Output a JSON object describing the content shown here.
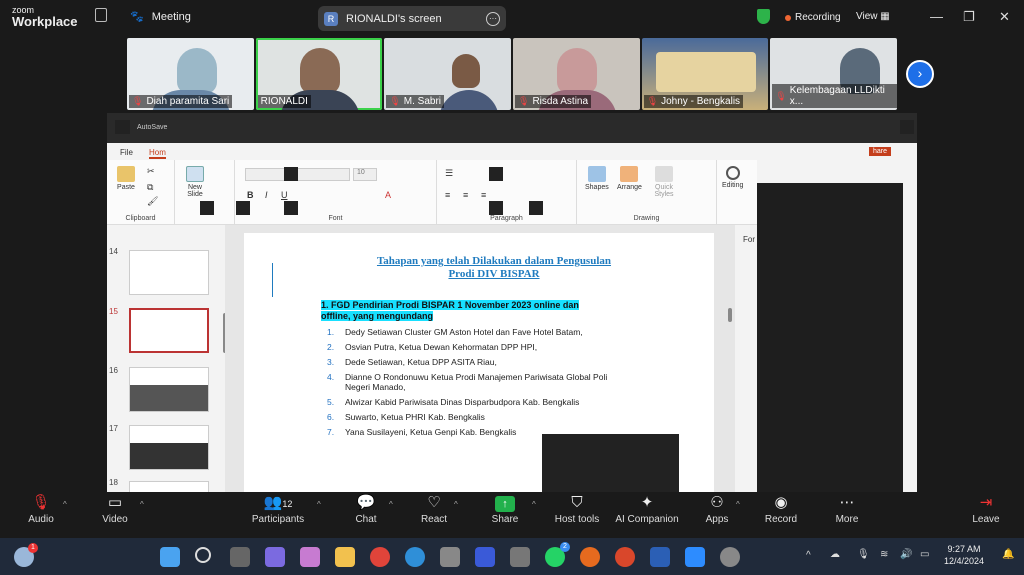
{
  "app": {
    "brand_top": "zoom",
    "brand_bottom": "Workplace",
    "meeting_label": "Meeting",
    "screen_label": "RIONALDI's screen",
    "screen_initial": "R",
    "recording_label": "Recording",
    "view_label": "View"
  },
  "participants": [
    {
      "name": "Diah paramita Sari",
      "muted": true
    },
    {
      "name": "RIONALDI",
      "muted": false
    },
    {
      "name": "M. Sabri",
      "muted": true
    },
    {
      "name": "Risda Astina",
      "muted": true
    },
    {
      "name": "Johny - Bengkalis",
      "muted": true
    },
    {
      "name": "Kelembagaan LLDikti x...",
      "muted": true
    }
  ],
  "ppt": {
    "autosave": "AutoSave",
    "menu_file": "File",
    "menu_home": "Hom",
    "share": "hare",
    "ribbon": {
      "paste": "Paste",
      "clipboard": "Clipboard",
      "new_slide": "New Slide",
      "font": "Font",
      "paragraph": "Paragraph",
      "shapes": "Shapes",
      "arrange": "Arrange",
      "quick_styles": "Quick Styles",
      "drawing": "Drawing",
      "editing": "Editing",
      "font_size": "10"
    },
    "slide_numbers": [
      "14",
      "15",
      "16",
      "17",
      "18"
    ],
    "right_label": "For",
    "slide": {
      "title_line1": "Tahapan yang telah Dilakukan dalam Pengusulan",
      "title_line2": "Prodi DIV BISPAR",
      "heading": "1. FGD Pendirian Prodi BISPAR 1 November 2023 online dan offline, yang mengundang",
      "items": [
        {
          "n": "1.",
          "text": "Dedy Setiawan Cluster GM Aston Hotel dan Fave Hotel Batam,"
        },
        {
          "n": "2.",
          "text": "Osvian Putra, Ketua Dewan Kehormatan DPP HPI,"
        },
        {
          "n": "3.",
          "text": "Dede Setiawan, Ketua DPP ASITA Riau,"
        },
        {
          "n": "4.",
          "text": "Dianne O Rondonuwu Ketua Prodi Manajemen Pariwisata Global Poli Negeri Manado,"
        },
        {
          "n": "5.",
          "text": "Alwizar Kabid Pariwisata Dinas Disparbudpora Kab. Bengkalis"
        },
        {
          "n": "6.",
          "text": "Suwarto, Ketua PHRI Kab. Bengkalis"
        },
        {
          "n": "7.",
          "text": "Yana Susilayeni, Ketua Genpi Kab. Bengkalis"
        }
      ]
    }
  },
  "toolbar": {
    "audio": "Audio",
    "video": "Video",
    "participants": "Participants",
    "participants_count": "12",
    "chat": "Chat",
    "react": "React",
    "share": "Share",
    "host_tools": "Host tools",
    "ai_companion": "AI Companion",
    "apps": "Apps",
    "record": "Record",
    "more": "More",
    "leave": "Leave"
  },
  "taskbar": {
    "time": "9:27 AM",
    "date": "12/4/2024",
    "weather_badge": "1",
    "whatsapp_badge": "2"
  }
}
